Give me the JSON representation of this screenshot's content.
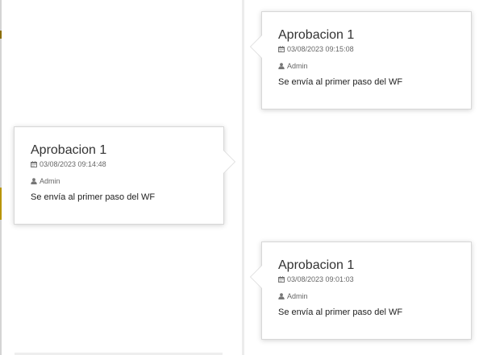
{
  "timeline": {
    "entries": [
      {
        "title": "Aprobacion 1",
        "datetime": "03/08/2023 09:15:08",
        "user": "Admin",
        "description": "Se envía al primer paso del WF",
        "side": "right",
        "date_icon": "calendar-icon",
        "user_icon": "user-icon"
      },
      {
        "title": "Aprobacion 1",
        "datetime": "03/08/2023 09:14:48",
        "user": "Admin",
        "description": "Se envía al primer paso del WF",
        "side": "left",
        "date_icon": "calendar-icon",
        "user_icon": "user-icon"
      },
      {
        "title": "Aprobacion 1",
        "datetime": "03/08/2023 09:01:03",
        "user": "Admin",
        "description": "Se envía al primer paso del WF",
        "side": "right",
        "date_icon": "calendar-icon",
        "user_icon": "user-icon"
      }
    ]
  },
  "colors": {
    "panel_border": "#d7d7d7",
    "axis": "#ececec",
    "text": "#333333",
    "meta_text": "#666666"
  }
}
